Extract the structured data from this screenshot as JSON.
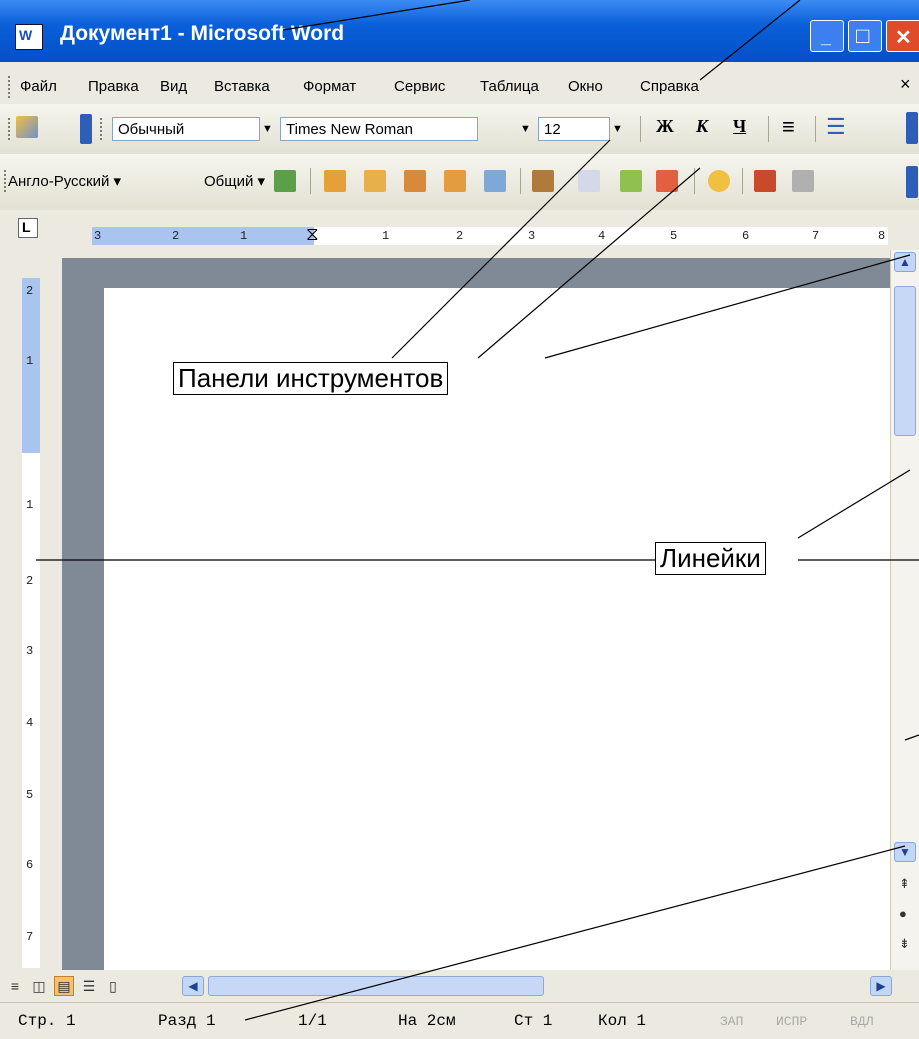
{
  "titlebar": {
    "title": "Документ1 - Microsoft Word",
    "app_icon_letter": "W",
    "min_glyph": "_",
    "max_glyph": "□",
    "close_glyph": "✕"
  },
  "menu": {
    "items": [
      "Файл",
      "Правка",
      "Вид",
      "Вставка",
      "Формат",
      "Сервис",
      "Таблица",
      "Окно",
      "Справка"
    ],
    "close_glyph": "×"
  },
  "format_toolbar": {
    "style": "Обычный",
    "font": "Times New Roman",
    "size": "12",
    "bold": "Ж",
    "italic": "К",
    "underline": "Ч"
  },
  "lang_toolbar": {
    "translate": "Англо-Русский ▾",
    "dictionary": "Общий ▾"
  },
  "ruler": {
    "h_labels": [
      "3",
      "2",
      "1",
      "1",
      "2",
      "3",
      "4",
      "5",
      "6",
      "7",
      "8"
    ],
    "v_labels": [
      "2",
      "1",
      "1",
      "2",
      "3",
      "4",
      "5",
      "6",
      "7"
    ]
  },
  "status": {
    "page": "Стр. 1",
    "section": "Разд 1",
    "pages": "1/1",
    "at": "На 2см",
    "line": "Ст 1",
    "col": "Кол 1",
    "rec": "ЗАП",
    "trk": "ИСПР",
    "ext": "ВДЛ"
  },
  "callouts": {
    "toolbars": "Панели инструментов",
    "rulers": "Линейки"
  },
  "colors": {
    "titlebar": "#0a5fd8",
    "close_button": "#e04c2a",
    "ruler_highlight": "#a9c4ee",
    "doc_background": "#808996"
  }
}
